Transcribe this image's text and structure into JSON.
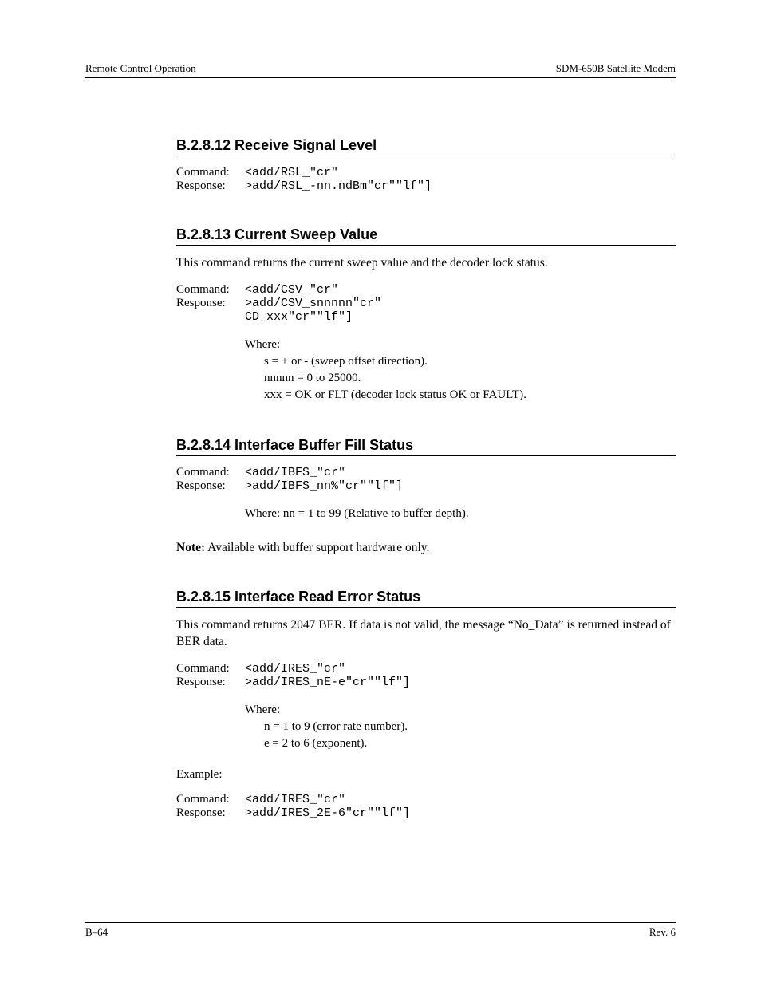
{
  "header": {
    "left": "Remote Control Operation",
    "right": "SDM-650B Satellite Modem"
  },
  "footer": {
    "left": "B–64",
    "right": "Rev. 6"
  },
  "labels": {
    "command": "Command:",
    "response": "Response:",
    "where": "Where:",
    "example": "Example:"
  },
  "sec12": {
    "heading": "B.2.8.12  Receive Signal Level",
    "cmd": "<add/RSL_\"cr\"",
    "resp": ">add/RSL_-nn.ndBm\"cr\"\"lf\"]"
  },
  "sec13": {
    "heading": "B.2.8.13  Current Sweep Value",
    "para": "This command returns the current sweep value and the decoder lock status.",
    "cmd": "<add/CSV_\"cr\"",
    "resp": ">add/CSV_snnnnn\"cr\"\nCD_xxx\"cr\"\"lf\"]",
    "where1": "s = + or - (sweep offset direction).",
    "where2": "nnnnn = 0 to 25000.",
    "where3": "xxx = OK or FLT (decoder lock status OK or FAULT)."
  },
  "sec14": {
    "heading": "B.2.8.14  Interface Buffer Fill Status",
    "cmd": "<add/IBFS_\"cr\"",
    "resp": ">add/IBFS_nn%\"cr\"\"lf\"]",
    "where_inline": "Where: nn = 1 to 99 (Relative to buffer depth).",
    "note_prefix": "Note:",
    "note_body": " Available with buffer support hardware only."
  },
  "sec15": {
    "heading": "B.2.8.15  Interface Read Error Status",
    "para": "This command returns 2047 BER. If data is not valid, the message “No_Data” is returned instead of BER data.",
    "cmd": "<add/IRES_\"cr\"",
    "resp": ">add/IRES_nE-e\"cr\"\"lf\"]",
    "where1": "n = 1 to 9 (error rate number).",
    "where2": "e = 2 to 6 (exponent).",
    "ex_cmd": "<add/IRES_\"cr\"",
    "ex_resp": ">add/IRES_2E-6\"cr\"\"lf\"]"
  }
}
